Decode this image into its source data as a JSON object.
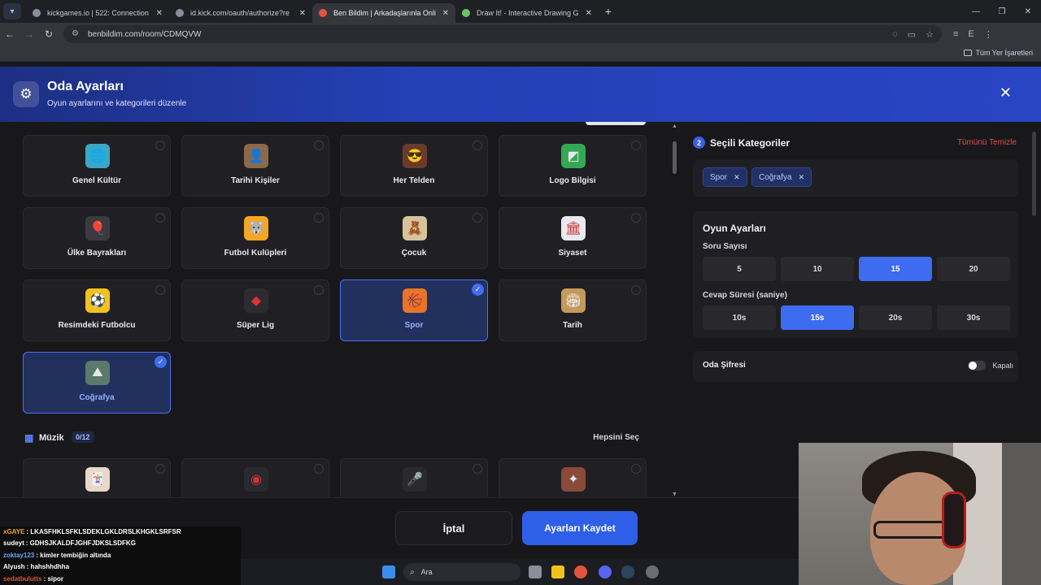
{
  "browser": {
    "tabs": [
      {
        "label": "kickgames.io | 522: Connection",
        "active": false,
        "favicon": "globe-icon"
      },
      {
        "label": "id.kick.com/oauth/authorize?re",
        "active": false,
        "favicon": "globe-icon"
      },
      {
        "label": "Ben Bildim | Arkadaşlarınla Onli",
        "active": true,
        "favicon": "benbildim-icon"
      },
      {
        "label": "Draw It! - Interactive Drawing G",
        "active": false,
        "favicon": "drawit-icon"
      }
    ],
    "url": "benbildim.com/room/CDMQVW",
    "profile_letter": "E",
    "bookmarks_label": "Tüm Yer İşaretleri"
  },
  "modal": {
    "title": "Oda Ayarları",
    "subtitle": "Oyun ayarlarını ve kategorileri düzenle"
  },
  "categories": [
    {
      "label": "Genel Kültür",
      "selected": false,
      "icon": "globe-icon",
      "color": "#3aa7c4"
    },
    {
      "label": "Tarihi Kişiler",
      "selected": false,
      "icon": "portrait-icon",
      "color": "#8a6a4a"
    },
    {
      "label": "Her Telden",
      "selected": false,
      "icon": "mixed-icon",
      "color": "#6a3a2a"
    },
    {
      "label": "Logo Bilgisi",
      "selected": false,
      "icon": "logo-icon",
      "color": "#34a853"
    },
    {
      "label": "Ülke Bayrakları",
      "selected": false,
      "icon": "flag-icon",
      "color": "#3a3a40"
    },
    {
      "label": "Futbol Kulüpleri",
      "selected": false,
      "icon": "wolf-icon",
      "color": "#f5a623"
    },
    {
      "label": "Çocuk",
      "selected": false,
      "icon": "kid-icon",
      "color": "#d7c39a"
    },
    {
      "label": "Siyaset",
      "selected": false,
      "icon": "parliament-icon",
      "color": "#e9e9ee"
    },
    {
      "label": "Resimdeki Futbolcu",
      "selected": false,
      "icon": "footballer-icon",
      "color": "#f2c21c"
    },
    {
      "label": "Süper Lig",
      "selected": false,
      "icon": "superlig-icon",
      "color": "#2b2b30"
    },
    {
      "label": "Spor",
      "selected": true,
      "icon": "ball-icon",
      "color": "#e8742a"
    },
    {
      "label": "Tarih",
      "selected": false,
      "icon": "colosseum-icon",
      "color": "#c49a5a"
    },
    {
      "label": "Coğrafya",
      "selected": true,
      "icon": "mountain-icon",
      "color": "#5a7a6a"
    }
  ],
  "music_section": {
    "title": "Müzik",
    "count": "0/12",
    "select_all": "Hepsini Seç",
    "icons": [
      "music-card-icon",
      "vinyl-icon",
      "microphone-icon",
      "instrument-icon"
    ]
  },
  "selected_panel": {
    "count": "2",
    "title": "Seçili Kategoriler",
    "clear_all": "Tümünü Temizle",
    "chips": [
      "Spor",
      "Coğrafya"
    ]
  },
  "game_settings": {
    "title": "Oyun Ayarları",
    "question_count_label": "Soru Sayısı",
    "question_counts": [
      "5",
      "10",
      "15",
      "20"
    ],
    "question_count_selected": "15",
    "answer_time_label": "Cevap Süresi (saniye)",
    "answer_times": [
      "10s",
      "15s",
      "20s",
      "30s"
    ],
    "answer_time_selected": "15s"
  },
  "room_password": {
    "label": "Oda Şifresi",
    "state": "Kapalı"
  },
  "footer": {
    "cancel": "İptal",
    "save": "Ayarları Kaydet"
  },
  "chat": [
    {
      "user": "xGAYE",
      "message": ": LKASFHKLSFKLSDEKLGKLDRSLKHGKLSRFSR",
      "color": "#f5a623"
    },
    {
      "user": "sudeyt",
      "message": ": GDHSJKALDFJGHFJDKSLSDFKG",
      "color": "#ffffff"
    },
    {
      "user": "zoktay123",
      "message": ": kimler tembiğin altında",
      "color": "#6aa7ff"
    },
    {
      "user": "Alyush",
      "message": ": hahshhdhha",
      "color": "#ffffff"
    },
    {
      "user": "sedatbulutts",
      "message": ": sipor",
      "color": "#e2533e"
    }
  ],
  "taskbar": {
    "search_placeholder": "Ara"
  },
  "colors": {
    "accent": "#3d6cf0",
    "header_gradient_start": "#1d2f83",
    "danger": "#e24a4a"
  }
}
